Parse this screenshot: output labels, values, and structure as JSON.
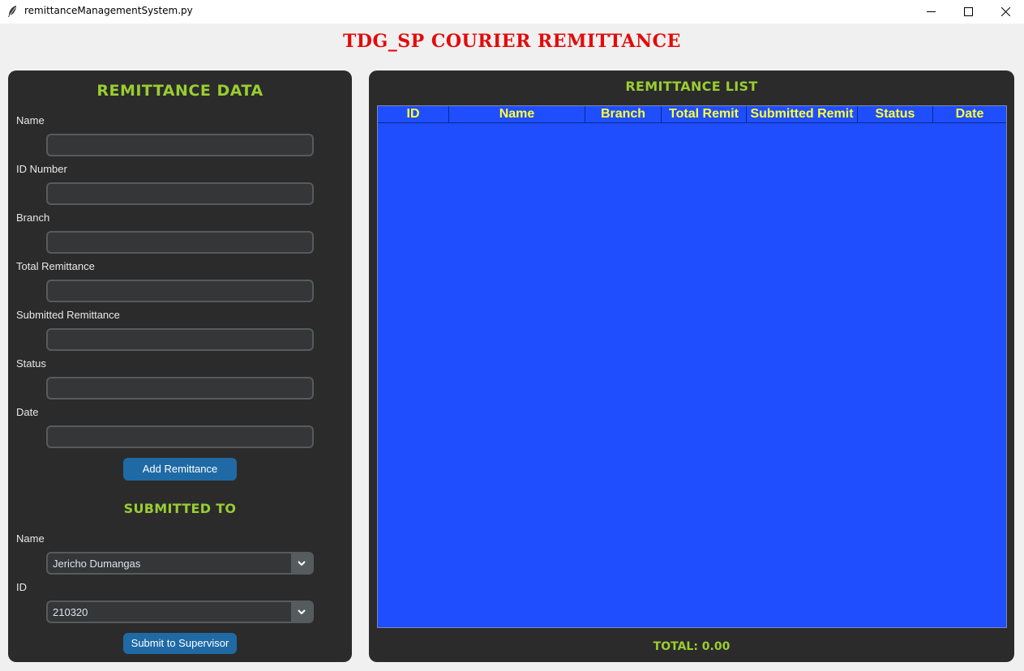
{
  "window": {
    "title": "remittanceManagementSystem.py"
  },
  "app": {
    "title": "TDG_SP COURIER REMITTANCE"
  },
  "left_panel": {
    "title": "REMITTANCE DATA",
    "fields": [
      {
        "label": "Name",
        "value": ""
      },
      {
        "label": "ID Number",
        "value": ""
      },
      {
        "label": "Branch",
        "value": ""
      },
      {
        "label": "Total Remittance",
        "value": ""
      },
      {
        "label": "Submitted Remittance",
        "value": ""
      },
      {
        "label": "Status",
        "value": ""
      },
      {
        "label": "Date",
        "value": ""
      }
    ],
    "add_button": "Add Remittance",
    "submitted_to": {
      "title": "SUBMITTED TO",
      "name_label": "Name",
      "name_value": "Jericho Dumangas",
      "id_label": "ID",
      "id_value": "210320"
    },
    "submit_button": "Submit to Supervisor"
  },
  "right_panel": {
    "title": "REMITTANCE LIST",
    "columns": [
      "ID",
      "Name",
      "Branch",
      "Total Remit",
      "Submitted Remit",
      "Status",
      "Date"
    ],
    "rows": [],
    "total": "TOTAL: 0.00"
  },
  "colors": {
    "title_red": "#e30b0b",
    "section_green": "#9acd32",
    "table_blue": "#1f4eff",
    "header_yellow": "#ffff33",
    "panel_dark": "#2b2b2b",
    "button_blue": "#1f6aa5"
  },
  "icons": {
    "window_icon": "feather-icon",
    "minimize": "minimize-icon",
    "maximize": "maximize-icon",
    "close": "close-icon",
    "dropdown": "chevron-down-icon"
  }
}
